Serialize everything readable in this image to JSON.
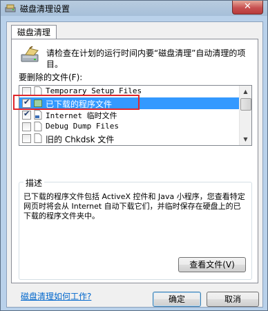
{
  "window": {
    "title": "磁盘清理设置",
    "close_glyph": "✕"
  },
  "tab": {
    "label": "磁盘清理"
  },
  "info": {
    "text": "请检查在计划的运行时间内要“磁盘清理”自动清理的项目。"
  },
  "files_list": {
    "label": "要删除的文件(F):",
    "items": [
      {
        "label": "Temporary Setup Files",
        "checked": false,
        "selected": false
      },
      {
        "label": "已下载的程序文件",
        "checked": true,
        "selected": true
      },
      {
        "label": "Internet 临时文件",
        "checked": true,
        "selected": false
      },
      {
        "label": "Debug Dump Files",
        "checked": false,
        "selected": false
      },
      {
        "label": "旧的 Chkdsk 文件",
        "checked": false,
        "selected": false
      }
    ]
  },
  "description": {
    "title": "描述",
    "text": "已下载的程序文件包括 ActiveX 控件和 Java 小程序，您查看特定网页时将会从 Internet 自动下载它们，并临时保存在硬盘上的已下载的程序文件夹中。",
    "view_files_button": "查看文件(V)"
  },
  "help_link": "磁盘清理如何工作?",
  "buttons": {
    "ok": "确定",
    "cancel": "取消"
  },
  "colors": {
    "selection": "#3399ff",
    "highlight_box": "#e0262b",
    "link": "#0066cc"
  }
}
